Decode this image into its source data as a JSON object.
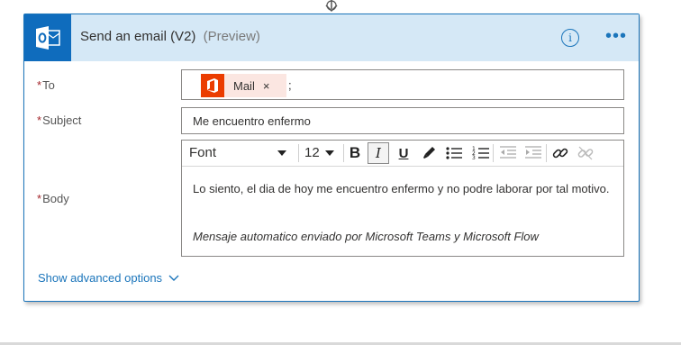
{
  "card": {
    "title": "Send an email (V2)",
    "preview": "(Preview)",
    "info_icon": "i",
    "more_icon": "•••",
    "header_color": "#d5e8f6",
    "accent_color": "#1b75bb",
    "app_icon": "outlook-icon"
  },
  "fields": {
    "required_mark": "*",
    "to": {
      "label": "To",
      "token": {
        "label": "Mail",
        "remove": "×",
        "icon": "office-icon",
        "icon_color": "#eb3c00"
      },
      "separator": ";"
    },
    "subject": {
      "label": "Subject",
      "value": "Me encuentro enfermo"
    },
    "body": {
      "label": "Body",
      "toolbar": {
        "font": "Font",
        "size": "12",
        "bold": "B",
        "italic": "I",
        "underline": "U",
        "buttons": [
          "bold-icon",
          "italic-icon",
          "underline-icon",
          "highlight-icon",
          "bullet-list-icon",
          "numbered-list-icon",
          "decrease-indent-icon",
          "increase-indent-icon",
          "link-icon",
          "unlink-icon"
        ]
      },
      "text": "Lo siento, el dia de hoy me encuentro enfermo y no podre laborar por tal motivo.",
      "signature": "Mensaje automatico enviado por Microsoft Teams y Microsoft Flow"
    }
  },
  "advanced_options": "Show advanced options"
}
